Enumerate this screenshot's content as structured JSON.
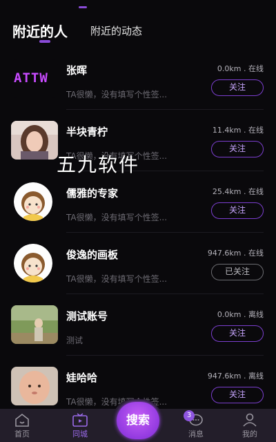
{
  "header": {
    "tab_active": "附近的人",
    "tab_inactive": "附近的动态"
  },
  "rows": [
    {
      "name": "张晖",
      "bio": "TA很懒，没有填写个性签...",
      "distance": "0.0km . 在线",
      "button": "关注",
      "avatar": "attw-logo",
      "avatar_text": "ATTW"
    },
    {
      "name": "半块青柠",
      "bio": "TA很懒，没有填写个性签...",
      "distance": "11.4km . 在线",
      "button": "关注",
      "avatar": "photo-woman"
    },
    {
      "name": "儒雅的专家",
      "bio": "TA很懒，没有填写个性签...",
      "distance": "25.4km . 在线",
      "button": "关注",
      "avatar": "cartoon-girl"
    },
    {
      "name": "俊逸的画板",
      "bio": "TA很懒，没有填写个性签...",
      "distance": "947.6km . 在线",
      "button": "已关注",
      "avatar": "cartoon-girl"
    },
    {
      "name": "测试账号",
      "bio": "测试",
      "distance": "0.0km . 离线",
      "button": "关注",
      "avatar": "photo-outdoor"
    },
    {
      "name": "娃哈哈",
      "bio": "TA很懒，没有填写个性签...",
      "distance": "947.6km . 离线",
      "button": "关注",
      "avatar": "photo-baby"
    }
  ],
  "watermark": "五九软件",
  "tabbar": {
    "home": "首页",
    "nearby": "同城",
    "search": "搜索",
    "messages": "消息",
    "messages_badge": "3",
    "profile": "我的"
  },
  "colors": {
    "accent": "#8a4bd8",
    "background": "#0a090c",
    "tabbar": "#231e2a"
  }
}
